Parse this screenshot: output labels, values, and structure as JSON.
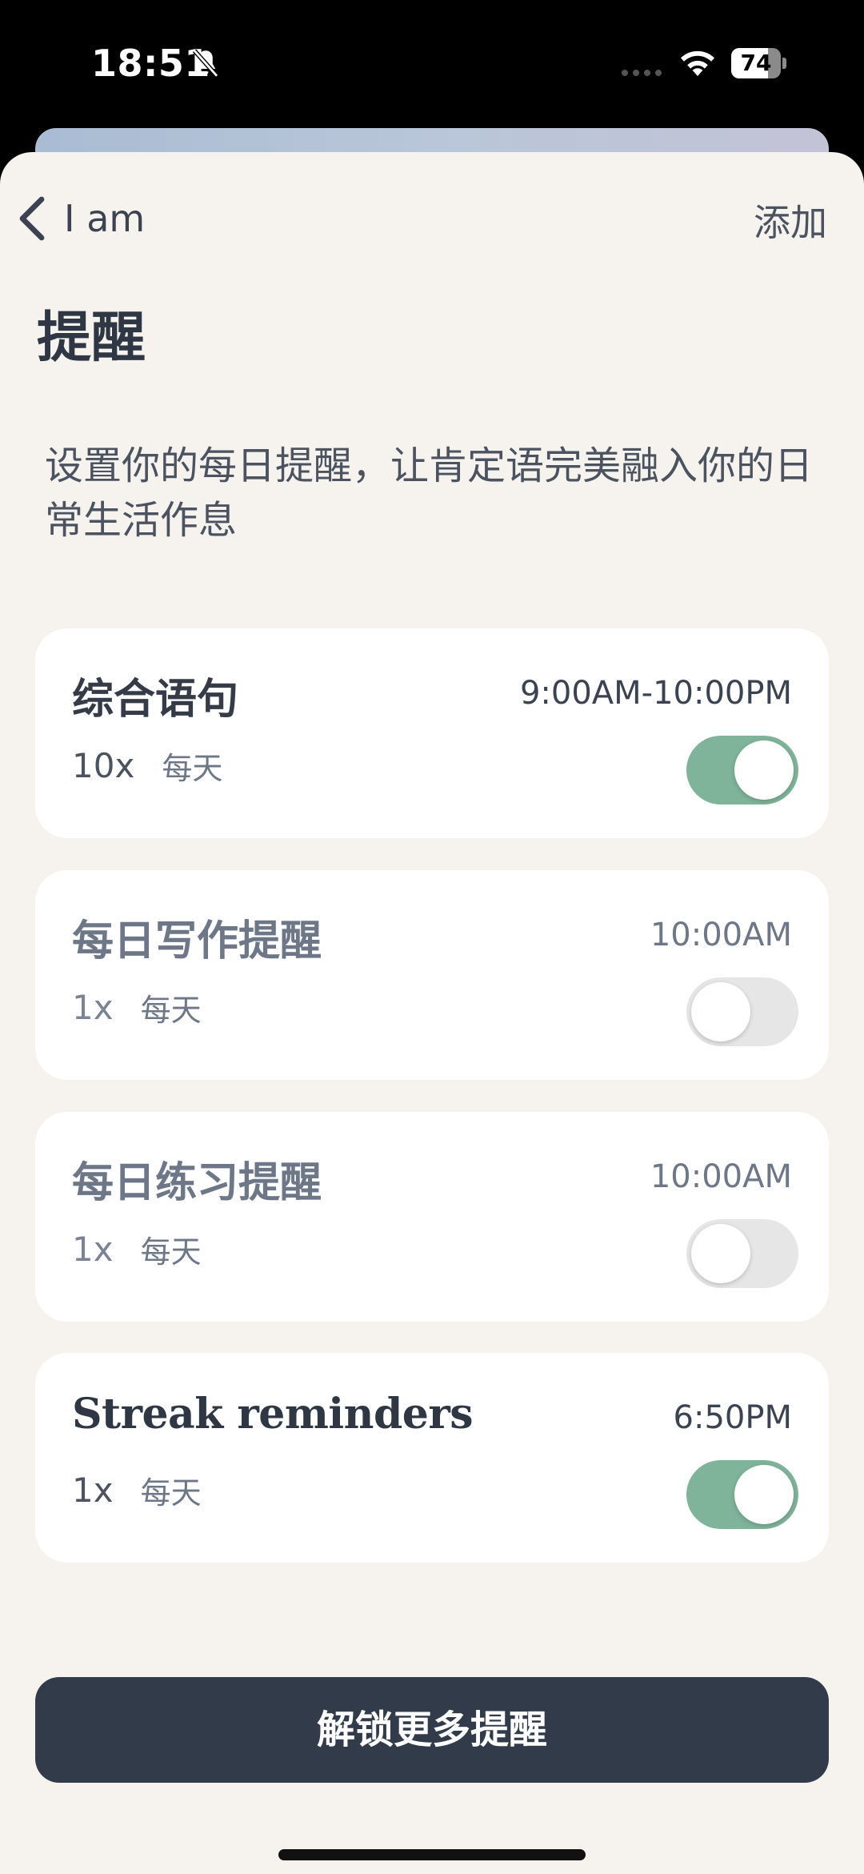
{
  "status_bar": {
    "time": "18:51",
    "battery_level": "74",
    "battery_fraction": 0.74,
    "icons": [
      "bell-off-icon",
      "signal-dots-icon",
      "wifi-icon",
      "battery-icon"
    ]
  },
  "nav": {
    "back_label": "I am",
    "add_label": "添加"
  },
  "title": "提醒",
  "description": "设置你的每日提醒，让肯定语完美融入你的日常生活作息",
  "reminders": [
    {
      "title": "综合语句",
      "time": "9:00AM-10:00PM",
      "count": "10x",
      "period": "每天",
      "enabled": true
    },
    {
      "title": "每日写作提醒",
      "time": "10:00AM",
      "count": "1x",
      "period": "每天",
      "enabled": false
    },
    {
      "title": "每日练习提醒",
      "time": "10:00AM",
      "count": "1x",
      "period": "每天",
      "enabled": false
    },
    {
      "title": "Streak reminders",
      "time": "6:50PM",
      "count": "1x",
      "period": "每天",
      "enabled": true
    }
  ],
  "unlock_button_label": "解锁更多提醒",
  "colors": {
    "toggle_on": "#7fb39a",
    "toggle_off": "#e6e6e6",
    "button": "#323b4a",
    "sheet_bg": "#f6f3ef"
  }
}
